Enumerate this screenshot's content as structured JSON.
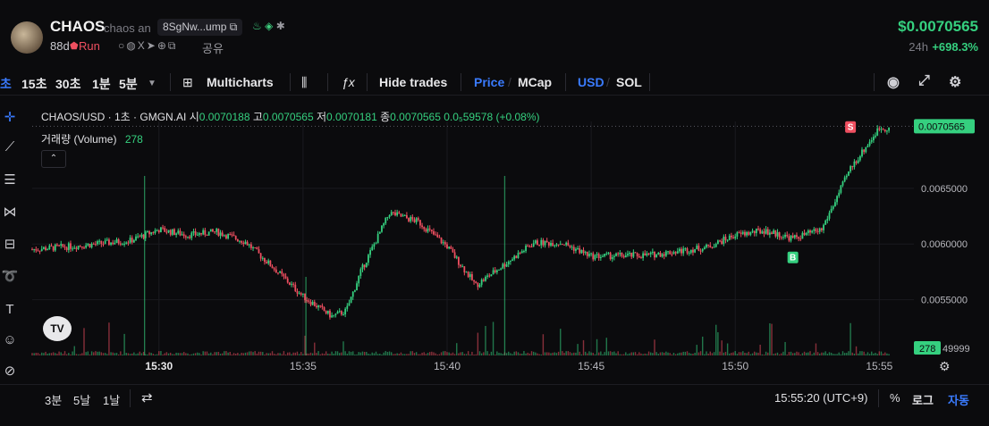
{
  "header": {
    "title": "CHAOS",
    "subtitle": "chaos an",
    "address": "8SgNw...ump",
    "age": "88d",
    "run_label": "Run",
    "share_label": "공유",
    "price": "$0.0070565",
    "change_label": "24h",
    "change_value": "+698.3%"
  },
  "toolbar": {
    "intervals": [
      "초",
      "15초",
      "30초",
      "1분",
      "5분"
    ],
    "multicharts": "Multicharts",
    "hide_trades": "Hide trades",
    "price": "Price",
    "slash1": "/",
    "mcap": "MCap",
    "usd": "USD",
    "slash2": "/",
    "sol": "SOL"
  },
  "legend": {
    "symbol": "CHAOS/USD · 1초 · GMGN.AI",
    "o_label": "시",
    "o_value": "0.0070188",
    "h_label": "고",
    "h_value": "0.0070565",
    "l_label": "저",
    "l_value": "0.0070181",
    "c_label": "종",
    "c_value": "0.0070565",
    "change": "0.0₅59578 (+0.08%)",
    "volume_label": "거래량 (Volume)",
    "volume_value": "278"
  },
  "footer": {
    "ranges": [
      "3분",
      "5날",
      "1날"
    ],
    "time": "15:55:20 (UTC+9)",
    "percent": "%",
    "log": "로그",
    "auto": "자동"
  },
  "colors": {
    "up": "#35d07f",
    "down": "#ef4f60",
    "accent": "#3a7bff",
    "background": "#0b0b0d"
  },
  "chart_data": {
    "type": "candlestick",
    "x_ticks": [
      "15:30",
      "15:35",
      "15:40",
      "15:45",
      "15:50",
      "15:55"
    ],
    "y_ticks": [
      "0.0070565",
      "0.0065000",
      "0.0060000",
      "0.0055000",
      "49999"
    ],
    "ylim": [
      0.0049999,
      0.0071
    ],
    "current_price_label": "0.0070565",
    "current_volume_label": "278",
    "markers": [
      {
        "label": "S",
        "time": "15:54",
        "price": 0.00699
      },
      {
        "label": "B",
        "time": "15:52",
        "price": 0.00598
      }
    ],
    "price_path": [
      {
        "t": "15:25",
        "v": 0.00594
      },
      {
        "t": "15:27",
        "v": 0.00598
      },
      {
        "t": "15:29",
        "v": 0.00603
      },
      {
        "t": "15:30",
        "v": 0.00613
      },
      {
        "t": "15:31",
        "v": 0.00608
      },
      {
        "t": "15:32",
        "v": 0.00611
      },
      {
        "t": "15:33",
        "v": 0.00602
      },
      {
        "t": "15:34",
        "v": 0.00578
      },
      {
        "t": "15:35",
        "v": 0.00553
      },
      {
        "t": "15:36",
        "v": 0.00535
      },
      {
        "t": "15:36.5",
        "v": 0.0054
      },
      {
        "t": "15:37",
        "v": 0.00575
      },
      {
        "t": "15:38",
        "v": 0.00628
      },
      {
        "t": "15:39",
        "v": 0.0062
      },
      {
        "t": "15:40",
        "v": 0.00598
      },
      {
        "t": "15:41",
        "v": 0.00563
      },
      {
        "t": "15:42",
        "v": 0.00582
      },
      {
        "t": "15:43",
        "v": 0.00601
      },
      {
        "t": "15:44",
        "v": 0.00601
      },
      {
        "t": "15:45",
        "v": 0.00589
      },
      {
        "t": "15:47",
        "v": 0.0059
      },
      {
        "t": "15:49",
        "v": 0.00597
      },
      {
        "t": "15:50",
        "v": 0.00608
      },
      {
        "t": "15:51",
        "v": 0.00612
      },
      {
        "t": "15:52",
        "v": 0.00605
      },
      {
        "t": "15:53",
        "v": 0.00613
      },
      {
        "t": "15:54",
        "v": 0.00668
      },
      {
        "t": "15:55",
        "v": 0.00704
      }
    ]
  }
}
